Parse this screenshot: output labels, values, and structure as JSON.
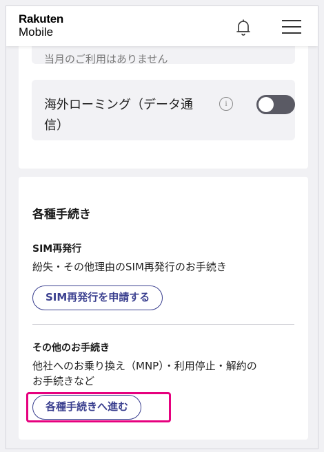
{
  "header": {
    "logo_top": "Rakuten",
    "logo_bottom": "Mobile",
    "bell_icon": "bell-icon",
    "menu_icon": "hamburger-menu-icon"
  },
  "usage": {
    "faded_text": "当月のご利用はありません",
    "roaming_label": "海外ローミング（データ通信）",
    "info_icon": "info-icon",
    "roaming_toggle_state": "off"
  },
  "procedures": {
    "title": "各種手続き",
    "sim": {
      "title": "SIM再発行",
      "description": "紛失・その他理由のSIM再発行のお手続き",
      "button_label": "SIM再発行を申請する"
    },
    "other": {
      "title": "その他のお手続き",
      "description_line1": "他社へのお乗り換え（MNP）・利用停止・解約の",
      "description_line2": "お手続きなど",
      "button_label": "各種手続きへ進む"
    }
  },
  "colors": {
    "accent": "#3a3f8f",
    "highlight": "#e6007e",
    "toggle_off": "#5a5a64"
  }
}
